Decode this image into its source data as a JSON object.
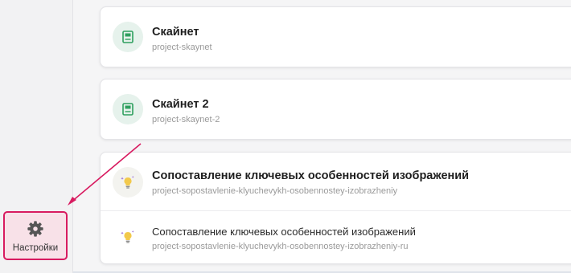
{
  "sidebar": {
    "settings": {
      "label": "Настройки",
      "icon": "gear-icon"
    }
  },
  "projects": [
    {
      "title": "Скайнет",
      "slug": "project-skaynet",
      "icon": "book-icon"
    },
    {
      "title": "Скайнет 2",
      "slug": "project-skaynet-2",
      "icon": "book-icon"
    },
    {
      "title": "Сопоставление ключевых особенностей изображений",
      "slug": "project-sopostavlenie-klyuchevykh-osobennostey-izobrazheniy",
      "icon": "lightbulb-icon",
      "subitem": {
        "title": "Сопоставление ключевых особенностей изображений",
        "slug": "project-sopostavlenie-klyuchevykh-osobennostey-izobrazheniy-ru",
        "icon": "lightbulb-icon"
      }
    }
  ],
  "colors": {
    "highlight": "#d81b60",
    "book_icon": "#2e9f5e",
    "bulb_icon": "#f2c94c"
  }
}
